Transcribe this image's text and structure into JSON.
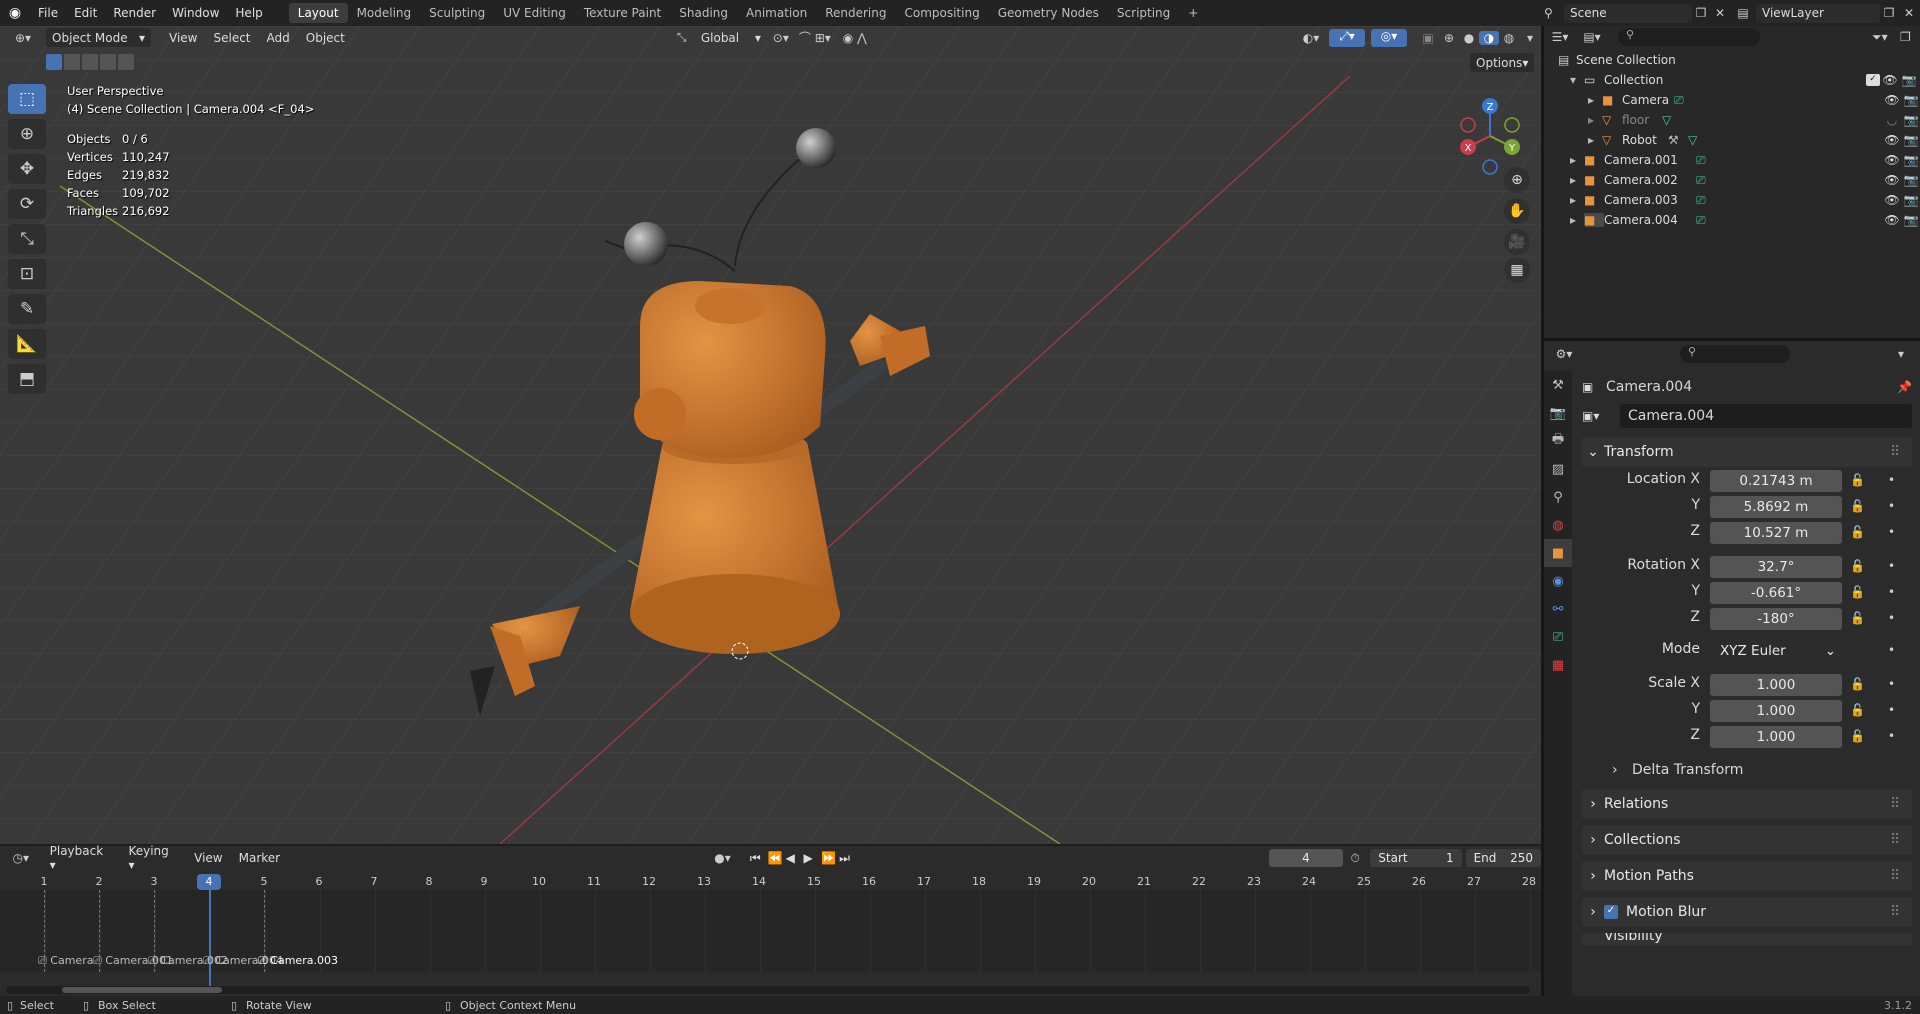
{
  "menubar": {
    "menus": [
      "File",
      "Edit",
      "Render",
      "Window",
      "Help"
    ],
    "workspaces": [
      "Layout",
      "Modeling",
      "Sculpting",
      "UV Editing",
      "Texture Paint",
      "Shading",
      "Animation",
      "Rendering",
      "Compositing",
      "Geometry Nodes",
      "Scripting"
    ],
    "active_workspace": "Layout",
    "add_tab": "+",
    "scene": "Scene",
    "view_layer": "ViewLayer"
  },
  "viewport": {
    "mode": "Object Mode",
    "menus": [
      "View",
      "Select",
      "Add",
      "Object"
    ],
    "transform_orientation": "Global",
    "options": "Options",
    "overlay_title": "User Perspective",
    "overlay_context": "(4) Scene Collection | Camera.004 <F_04>",
    "stats": [
      {
        "k": "Objects",
        "v": "0 / 6"
      },
      {
        "k": "Vertices",
        "v": "110,247"
      },
      {
        "k": "Edges",
        "v": "219,832"
      },
      {
        "k": "Faces",
        "v": "109,702"
      },
      {
        "k": "Triangles",
        "v": "216,692"
      }
    ],
    "gizmo": {
      "x": "X",
      "y": "Y",
      "z": "Z"
    }
  },
  "outliner": {
    "root": "Scene Collection",
    "items": [
      {
        "label": "Collection",
        "indent": 1
      },
      {
        "label": "Camera",
        "indent": 2
      },
      {
        "label": "floor",
        "indent": 2
      },
      {
        "label": "Robot",
        "indent": 2
      },
      {
        "label": "Camera.001",
        "indent": 1
      },
      {
        "label": "Camera.002",
        "indent": 1
      },
      {
        "label": "Camera.003",
        "indent": 1
      },
      {
        "label": "Camera.004",
        "indent": 1
      }
    ]
  },
  "properties": {
    "object_name": "Camera.004",
    "datablock_name": "Camera.004",
    "transform_title": "Transform",
    "location_label": "Location X",
    "rotation_label": "Rotation X",
    "scale_label": "Scale X",
    "y_label": "Y",
    "z_label": "Z",
    "location": [
      "0.21743 m",
      "5.8692 m",
      "10.527 m"
    ],
    "rotation": [
      "32.7°",
      "-0.661°",
      "-180°"
    ],
    "mode_label": "Mode",
    "mode_value": "XYZ Euler",
    "scale": [
      "1.000",
      "1.000",
      "1.000"
    ],
    "panels": [
      "Delta Transform",
      "Relations",
      "Collections",
      "Motion Paths",
      "Motion Blur"
    ],
    "cut_panel": "Visibility"
  },
  "timeline": {
    "menus": [
      "Playback",
      "Keying",
      "View",
      "Marker"
    ],
    "current_frame": "4",
    "start_label": "Start",
    "start": "1",
    "end_label": "End",
    "end": "250",
    "frames": [
      "1",
      "2",
      "3",
      "4",
      "5",
      "6",
      "7",
      "8",
      "9",
      "10",
      "11",
      "12",
      "13",
      "14",
      "15",
      "16",
      "17",
      "18",
      "19",
      "20",
      "21",
      "22",
      "23",
      "24",
      "25",
      "26",
      "27",
      "28"
    ],
    "markers": [
      "Camera",
      "Camera.001",
      "Camera.002",
      "Camera.004",
      "Camera.003"
    ]
  },
  "statusbar": {
    "select": "Select",
    "box_select": "Box Select",
    "rotate_view": "Rotate View",
    "context_menu": "Object Context Menu",
    "version": "3.1.2"
  },
  "colors": {
    "accent": "#4772b3",
    "robot_orange": "#d27b2e",
    "x_axis": "#c73e4e",
    "y_axis": "#7ea434",
    "z_axis": "#3a78d0"
  }
}
